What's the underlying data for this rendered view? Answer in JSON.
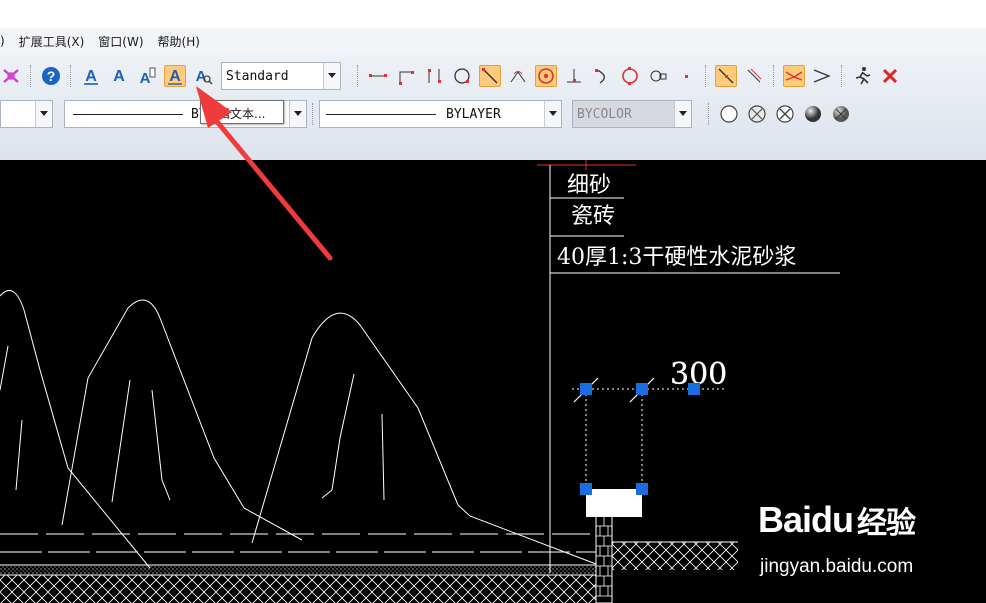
{
  "menu": {
    "items": [
      {
        "label": ")"
      },
      {
        "label": "扩展工具(X)"
      },
      {
        "label": "窗口(W)"
      },
      {
        "label": "帮助(H)"
      }
    ]
  },
  "toolbar": {
    "text_style_value": "Standard",
    "linetype_value": "BYLAYER",
    "color_value": "BYCOLOR",
    "layer_line_label": "BY",
    "active_tool": "edit-text"
  },
  "tooltip": {
    "text": "编辑文本..."
  },
  "drawing": {
    "labels": [
      {
        "text": "细砂"
      },
      {
        "text": "瓷砖"
      },
      {
        "text": "40厚1:3干硬性水泥砂浆"
      }
    ],
    "dimension_text": "300"
  },
  "watermark": {
    "brand": "Baidu",
    "brand_cn": "经验",
    "url": "jingyan.baidu.com"
  },
  "colors": {
    "canvas_bg": "#000000",
    "toolbar_bg": "#e4e9f0",
    "active_tool_bg": "#ffcb7a",
    "grip_blue": "#1a6fe0",
    "arrow_red": "#ef3b3b"
  }
}
